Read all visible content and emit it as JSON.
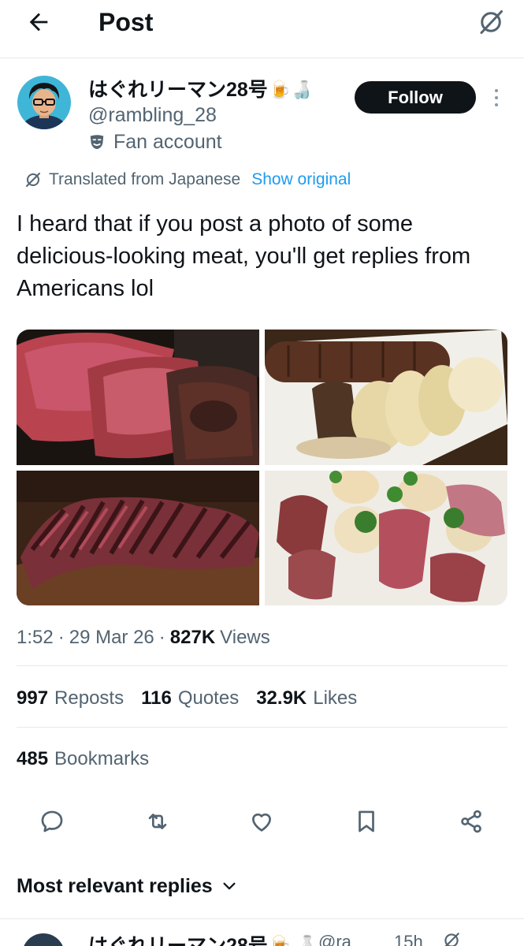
{
  "header": {
    "title": "Post",
    "back_icon": "arrow-left-icon",
    "translate_icon": "translate-slash-icon"
  },
  "author": {
    "display_name": "はぐれリーマン28号",
    "name_emojis": "🍺🍶",
    "handle": "@rambling_28",
    "account_label": "Fan account",
    "follow_label": "Follow"
  },
  "translation": {
    "notice": "Translated from Japanese",
    "show_original": "Show original"
  },
  "post": {
    "text": "I heard that if you post a photo of some delicious-looking meat, you'll get replies from Americans lol",
    "time": "1:52",
    "date": "29 Mar 26",
    "views_count": "827K",
    "views_label": "Views"
  },
  "stats": {
    "reposts": {
      "count": "997",
      "label": "Reposts"
    },
    "quotes": {
      "count": "116",
      "label": "Quotes"
    },
    "likes": {
      "count": "32.9K",
      "label": "Likes"
    },
    "bookmarks": {
      "count": "485",
      "label": "Bookmarks"
    }
  },
  "actions": [
    "reply-icon",
    "repost-icon",
    "like-icon",
    "bookmark-icon",
    "share-icon"
  ],
  "replies": {
    "filter_label": "Most relevant replies",
    "first_reply": {
      "name": "はぐれリーマン28号🍺🍶",
      "handle": "@ra",
      "time": "15h"
    }
  },
  "colors": {
    "text": "#0f1419",
    "secondary": "#536471",
    "link": "#1d9bf0",
    "follow_bg": "#0f1419"
  }
}
